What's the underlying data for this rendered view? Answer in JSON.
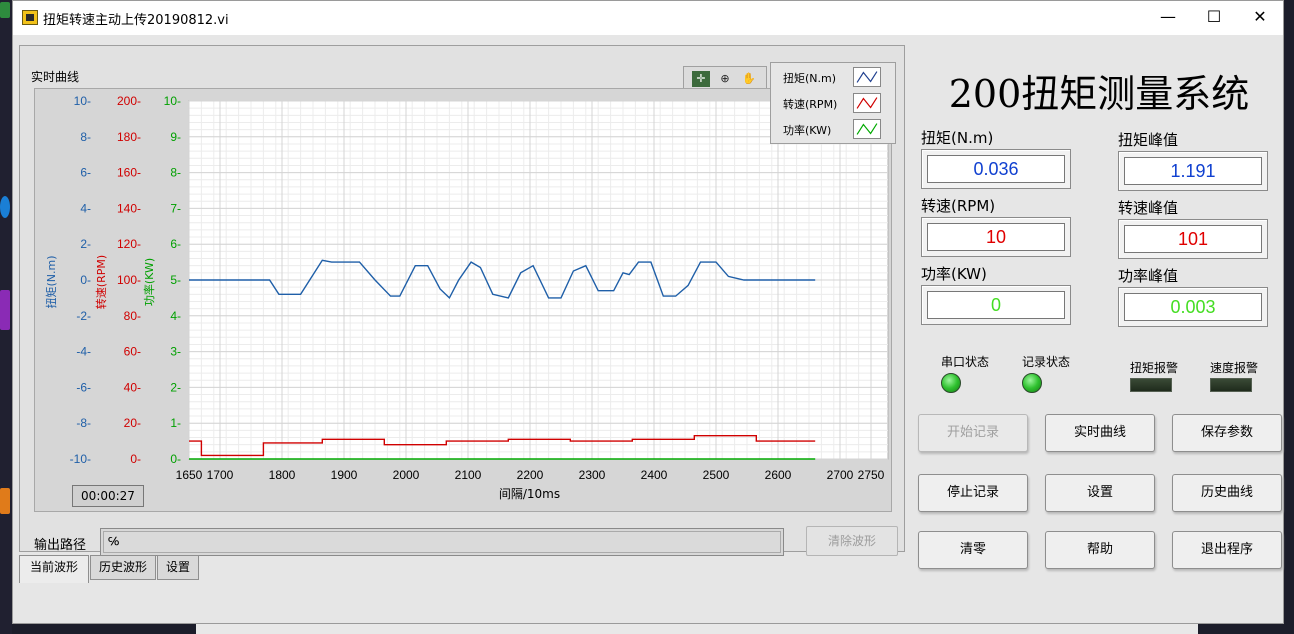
{
  "window": {
    "title": "扭矩转速主动上传20190812.vi",
    "minimize": "—",
    "maximize": "☐",
    "close": "✕"
  },
  "chart_panel": {
    "label": "实时曲线",
    "timer": "00:00:27",
    "path_label": "输出路径",
    "path_icon": "℅",
    "clear_button": "清除波形"
  },
  "tabs": [
    "当前波形",
    "历史波形",
    "设置"
  ],
  "legend": [
    {
      "name": "扭矩(N.m)",
      "color": "#1f3f8f"
    },
    {
      "name": "转速(RPM)",
      "color": "#d00000"
    },
    {
      "name": "功率(KW)",
      "color": "#00aa00"
    }
  ],
  "chart_data": {
    "type": "line",
    "xlabel": "间隔/10ms",
    "xlim": [
      1650,
      2750
    ],
    "x_ticks": [
      "1650",
      "1700",
      "1800",
      "1900",
      "2000",
      "2100",
      "2200",
      "2300",
      "2400",
      "2500",
      "2600",
      "2700",
      "2750"
    ],
    "axes": [
      {
        "ylabel": "扭矩(N.m)",
        "ylim": [
          -10,
          10
        ],
        "ticks": [
          "10",
          "8",
          "6",
          "4",
          "2",
          "0",
          "-2",
          "-4",
          "-6",
          "-8",
          "-10"
        ],
        "color": "#1f5fa8"
      },
      {
        "ylabel": "转速(RPM)",
        "ylim": [
          0,
          200
        ],
        "ticks": [
          "200",
          "180",
          "160",
          "140",
          "120",
          "100",
          "80",
          "60",
          "40",
          "20",
          "0"
        ],
        "color": "#d00000"
      },
      {
        "ylabel": "功率(KW)",
        "ylim": [
          0,
          10
        ],
        "ticks": [
          "10",
          "9",
          "8",
          "7",
          "6",
          "5",
          "4",
          "3",
          "2",
          "1",
          "0"
        ],
        "color": "#00a000"
      }
    ],
    "grid": true,
    "series": [
      {
        "name": "扭矩(N.m)",
        "axis": 0,
        "color": "#1f5fa8",
        "x": [
          1650,
          1780,
          1795,
          1830,
          1865,
          1880,
          1925,
          1950,
          1975,
          1990,
          2015,
          2035,
          2055,
          2070,
          2085,
          2105,
          2120,
          2140,
          2165,
          2185,
          2205,
          2230,
          2250,
          2270,
          2290,
          2310,
          2335,
          2350,
          2360,
          2375,
          2395,
          2415,
          2435,
          2455,
          2475,
          2500,
          2520,
          2545,
          2580,
          2660
        ],
        "y": [
          0.0,
          0.0,
          -0.8,
          -0.8,
          1.1,
          1.0,
          1.0,
          0.0,
          -0.9,
          -0.9,
          0.8,
          0.8,
          -0.5,
          -1.0,
          0.0,
          1.0,
          0.7,
          -0.8,
          -1.0,
          0.4,
          0.8,
          -1.0,
          -1.0,
          0.5,
          0.8,
          -0.6,
          -0.6,
          0.4,
          0.3,
          1.0,
          1.0,
          -0.9,
          -0.9,
          -0.3,
          1.0,
          1.0,
          0.2,
          0.0,
          0.0,
          0.0
        ]
      },
      {
        "name": "转速(RPM)",
        "axis": 1,
        "color": "#d00000",
        "x": [
          1650,
          1670,
          1670,
          1770,
          1770,
          1865,
          1865,
          1965,
          1965,
          2065,
          2065,
          2165,
          2165,
          2265,
          2265,
          2365,
          2365,
          2465,
          2465,
          2565,
          2565,
          2660
        ],
        "y": [
          10,
          10,
          2,
          2,
          9,
          9,
          11,
          11,
          8,
          8,
          10,
          10,
          11,
          11,
          10,
          10,
          11,
          11,
          13,
          13,
          10,
          10
        ]
      },
      {
        "name": "功率(KW)",
        "axis": 2,
        "color": "#00aa00",
        "x": [
          1650,
          2660
        ],
        "y": [
          0,
          0
        ]
      }
    ]
  },
  "system_title": "200扭矩测量系统",
  "readouts": {
    "torque_label": "扭矩(N.m)",
    "torque_value": "0.036",
    "torque_peak_label": "扭矩峰值",
    "torque_peak_value": "1.191",
    "speed_label": "转速(RPM)",
    "speed_value": "10",
    "speed_peak_label": "转速峰值",
    "speed_peak_value": "101",
    "power_label": "功率(KW)",
    "power_value": "0",
    "power_peak_label": "功率峰值",
    "power_peak_value": "0.003",
    "value_colors": {
      "torque": "#1040d0",
      "speed": "#e00000",
      "power": "#44dd22"
    }
  },
  "status": {
    "serial": "串口状态",
    "record": "记录状态",
    "torque_alarm": "扭矩报警",
    "speed_alarm": "速度报警"
  },
  "buttons": {
    "start_record": "开始记录",
    "realtime_curve": "实时曲线",
    "save_params": "保存参数",
    "stop_record": "停止记录",
    "settings": "设置",
    "history_curve": "历史曲线",
    "zero": "清零",
    "help": "帮助",
    "exit": "退出程序"
  }
}
